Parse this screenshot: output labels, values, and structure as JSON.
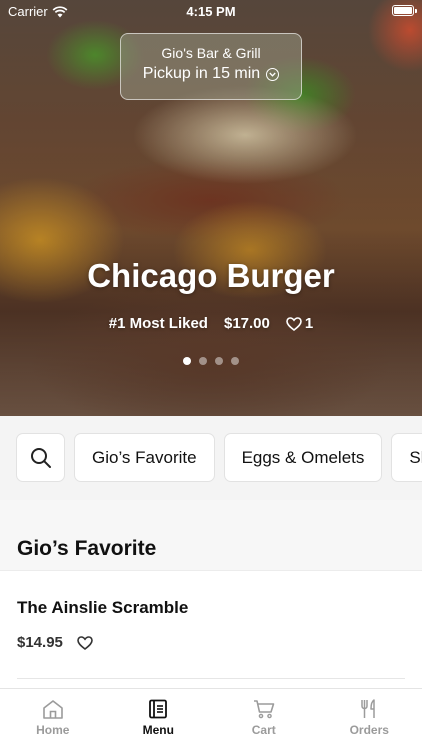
{
  "status_bar": {
    "carrier": "Carrier",
    "time": "4:15 PM"
  },
  "pickup": {
    "restaurant": "Gio's Bar & Grill",
    "eta": "Pickup in 15 min"
  },
  "hero": {
    "title": "Chicago Burger",
    "rank": "#1 Most Liked",
    "price": "$17.00",
    "likes": "1",
    "slide_count": 4,
    "active_slide": 1
  },
  "categories": [
    "Gio’s Favorite",
    "Eggs & Omelets",
    "Sk"
  ],
  "section": {
    "title": "Gio’s Favorite"
  },
  "items": [
    {
      "name": "The Ainslie Scramble",
      "price": "$14.95"
    }
  ],
  "tabs": [
    {
      "label": "Home",
      "icon": "home-icon",
      "active": false
    },
    {
      "label": "Menu",
      "icon": "menu-book-icon",
      "active": true
    },
    {
      "label": "Cart",
      "icon": "cart-icon",
      "active": false
    },
    {
      "label": "Orders",
      "icon": "fork-knife-icon",
      "active": false
    }
  ],
  "colors": {
    "active_tab": "#111111",
    "inactive_tab": "#9b9b9b",
    "background": "#f4f4f4"
  }
}
